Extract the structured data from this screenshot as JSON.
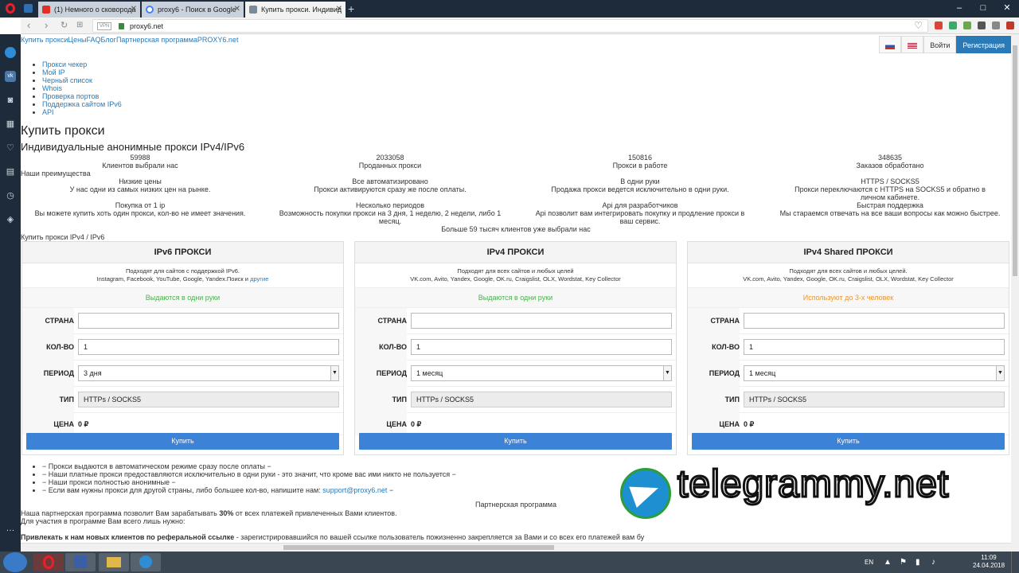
{
  "browser": {
    "tabs": [
      {
        "label": "(1) Немного о сковорода",
        "favicon_color": "#e52d27"
      },
      {
        "label": "proxy6 - Поиск в Google",
        "favicon_color": "#4285f4"
      },
      {
        "label": "Купить прокси. Индивид",
        "favicon_color": "#7b8a99"
      }
    ],
    "url": "proxy6.net",
    "vpn_label": "VPN"
  },
  "site": {
    "top_links": "Купить проксиЦеныFAQБлогПартнерская программаPROXY6.net",
    "login": "Войти",
    "register": "Регистрация",
    "menu": [
      "Прокси чекер",
      "Мой IP",
      "Черный список",
      "Whois",
      "Проверка портов",
      "Поддержка сайтом IPv6",
      "API"
    ],
    "h1": "Купить прокси",
    "h2": "Индивидуальные анонимные прокси IPv4/IPv6",
    "stats": [
      {
        "value": "59988",
        "label": "Клиентов выбрали нас"
      },
      {
        "value": "2033058",
        "label": "Проданных прокси"
      },
      {
        "value": "150816",
        "label": "Прокси в работе"
      },
      {
        "value": "348635",
        "label": "Заказов обработано"
      }
    ],
    "advantages_title": "Наши преимущества",
    "advantages": [
      {
        "title": "Низкие цены",
        "text": "У нас одни из самых низких цен на рынке."
      },
      {
        "title": "Все автоматизировано",
        "text": "Прокси активируются сразу же после оплаты."
      },
      {
        "title": "В одни руки",
        "text": "Продажа прокси ведется исключительно в одни руки."
      },
      {
        "title": "HTTPS / SOCKS5",
        "text": "Прокси переключаются с HTTPS на SOCKS5 и обратно в личном кабинете."
      },
      {
        "title": "Покупка от 1 ip",
        "text": "Вы можете купить хоть один прокси, кол-во не имеет значения."
      },
      {
        "title": "Несколько периодов",
        "text": "Возможность покупки прокси на 3 дня, 1 неделю, 2 недели, либо 1 месяц."
      },
      {
        "title": "Api для разработчиков",
        "text": "Api позволит вам интегрировать покупку и продление прокси в ваш сервис."
      },
      {
        "title": "Быстрая поддержка",
        "text": "Мы стараемся отвечать на все ваши вопросы как можно быстрее."
      }
    ],
    "clients_note": "Больше 59 тысяч клиентов уже выбрали нас",
    "buy_section_label": "Купить прокси IPv4 / IPv6",
    "field_labels": {
      "country": "СТРАНА",
      "qty": "КОЛ-ВО",
      "period": "ПЕРИОД",
      "type": "ТИП",
      "price": "ЦЕНА"
    },
    "cards": [
      {
        "title": "IPv6 ПРОКСИ",
        "desc1": "Подходят для сайтов с поддержкой IPv6.",
        "desc2": "Instagram, Facebook, YouTube, Google, Yandex.Поиск и ",
        "desc2_link": "другие",
        "note": "Выдаются в одни руки",
        "note_color": "#4caf50",
        "qty": "1",
        "period": "3 дня",
        "type": "HTTPs / SOCKS5",
        "price": "0 ₽",
        "buy": "Купить"
      },
      {
        "title": "IPv4 ПРОКСИ",
        "desc1": "Подходят для всех сайтов и любых целей",
        "desc2": "VK.com, Avito, Yandex, Google, OK.ru, Craigslist, OLX, Wordstat, Key Collector",
        "desc2_link": "",
        "note": "Выдаются в одни руки",
        "note_color": "#4caf50",
        "qty": "1",
        "period": "1 месяц",
        "type": "HTTPs / SOCKS5",
        "price": "0 ₽",
        "buy": "Купить"
      },
      {
        "title": "IPv4 Shared ПРОКСИ",
        "desc1": "Подходят для всех сайтов и любых целей.",
        "desc2": "VK.com, Avito, Yandex, Google, OK.ru, Craigslist, OLX, Wordstat, Key Collector",
        "desc2_link": "",
        "note": "Используют до 3-х человек",
        "note_color": "#e8962e",
        "qty": "1",
        "period": "1 месяц",
        "type": "HTTPs / SOCKS5",
        "price": "0 ₽",
        "buy": "Купить"
      }
    ],
    "bullets": [
      "− Прокси выдаются в автоматическом режиме сразу после оплаты −",
      "− Наши платные прокси предоставляются исключительно в одни руки - это значит, что кроме вас ими никто не пользуется −",
      "− Наши прокси полностью анонимные −"
    ],
    "bullet_last": "− Если вам нужны прокси для другой страны, либо большее кол-во, напишите нам: ",
    "bullet_email": "support@proxy6.net",
    "bullet_tail": " −",
    "partner_title": "Партнерская программа",
    "partner_text1": "Наша партнерская программа позволит Вам зарабатывать ",
    "partner_pct": "30%",
    "partner_text1b": " от всех платежей привлеченных Вами клиентов.",
    "partner_text2": "Для участия в программе Вам всего лишь нужно:",
    "partner_bold": "Привлекать к нам новых клиентов по реферальной ссылке",
    "partner_rest": " - зарегистрировавшийся по вашей ссылке пользователь пожизненно закрепляется за Вами и со всех его платежей вам бу"
  },
  "watermark": "telegrammy.net",
  "taskbar": {
    "lang": "EN",
    "time": "11:09",
    "date": "24.04.2018"
  }
}
